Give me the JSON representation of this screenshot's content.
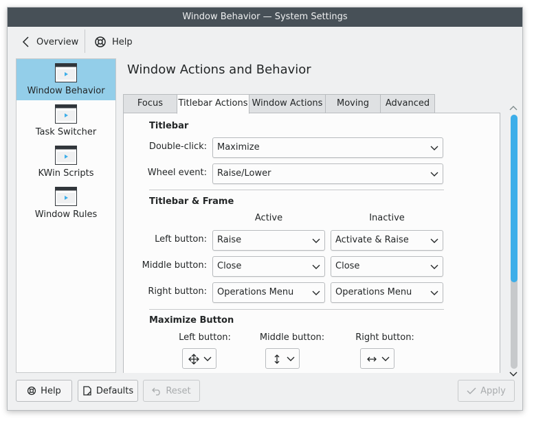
{
  "window": {
    "title": "Window Behavior  — System Settings"
  },
  "toolbar": {
    "overview_label": "Overview",
    "help_label": "Help"
  },
  "sidebar": {
    "items": [
      {
        "label": "Window Behavior",
        "selected": true
      },
      {
        "label": "Task Switcher",
        "selected": false
      },
      {
        "label": "KWin Scripts",
        "selected": false
      },
      {
        "label": "Window Rules",
        "selected": false
      }
    ]
  },
  "main": {
    "title": "Window Actions and Behavior",
    "tabs": [
      {
        "label": "Focus"
      },
      {
        "label": "Titlebar Actions"
      },
      {
        "label": "Window Actions"
      },
      {
        "label": "Moving"
      },
      {
        "label": "Advanced"
      }
    ],
    "active_tab": "Titlebar Actions"
  },
  "titlebar_section": {
    "heading": "Titlebar",
    "double_click_label": "Double-click:",
    "double_click_value": "Maximize",
    "wheel_event_label": "Wheel event:",
    "wheel_event_value": "Raise/Lower"
  },
  "frame_section": {
    "heading": "Titlebar & Frame",
    "active_header": "Active",
    "inactive_header": "Inactive",
    "left_button_label": "Left button:",
    "left_active": "Raise",
    "left_inactive": "Activate & Raise",
    "middle_button_label": "Middle button:",
    "middle_active": "Close",
    "middle_inactive": "Close",
    "right_button_label": "Right button:",
    "right_active": "Operations Menu",
    "right_inactive": "Operations Menu"
  },
  "maximize_section": {
    "heading": "Maximize Button",
    "left_label": "Left button:",
    "left_icon": "move-both-arrows-icon",
    "middle_label": "Middle button:",
    "middle_icon": "vertical-arrows-icon",
    "right_label": "Right button:",
    "right_icon": "horizontal-arrows-icon"
  },
  "scrollbar": {
    "position": 0.0,
    "visible_fraction": 0.66
  },
  "footer": {
    "help_label": "Help",
    "defaults_label": "Defaults",
    "reset_label": "Reset",
    "apply_label": "Apply"
  },
  "colors": {
    "accent": "#3daee9",
    "selection": "#93cee9",
    "titlebar": "#475057"
  }
}
